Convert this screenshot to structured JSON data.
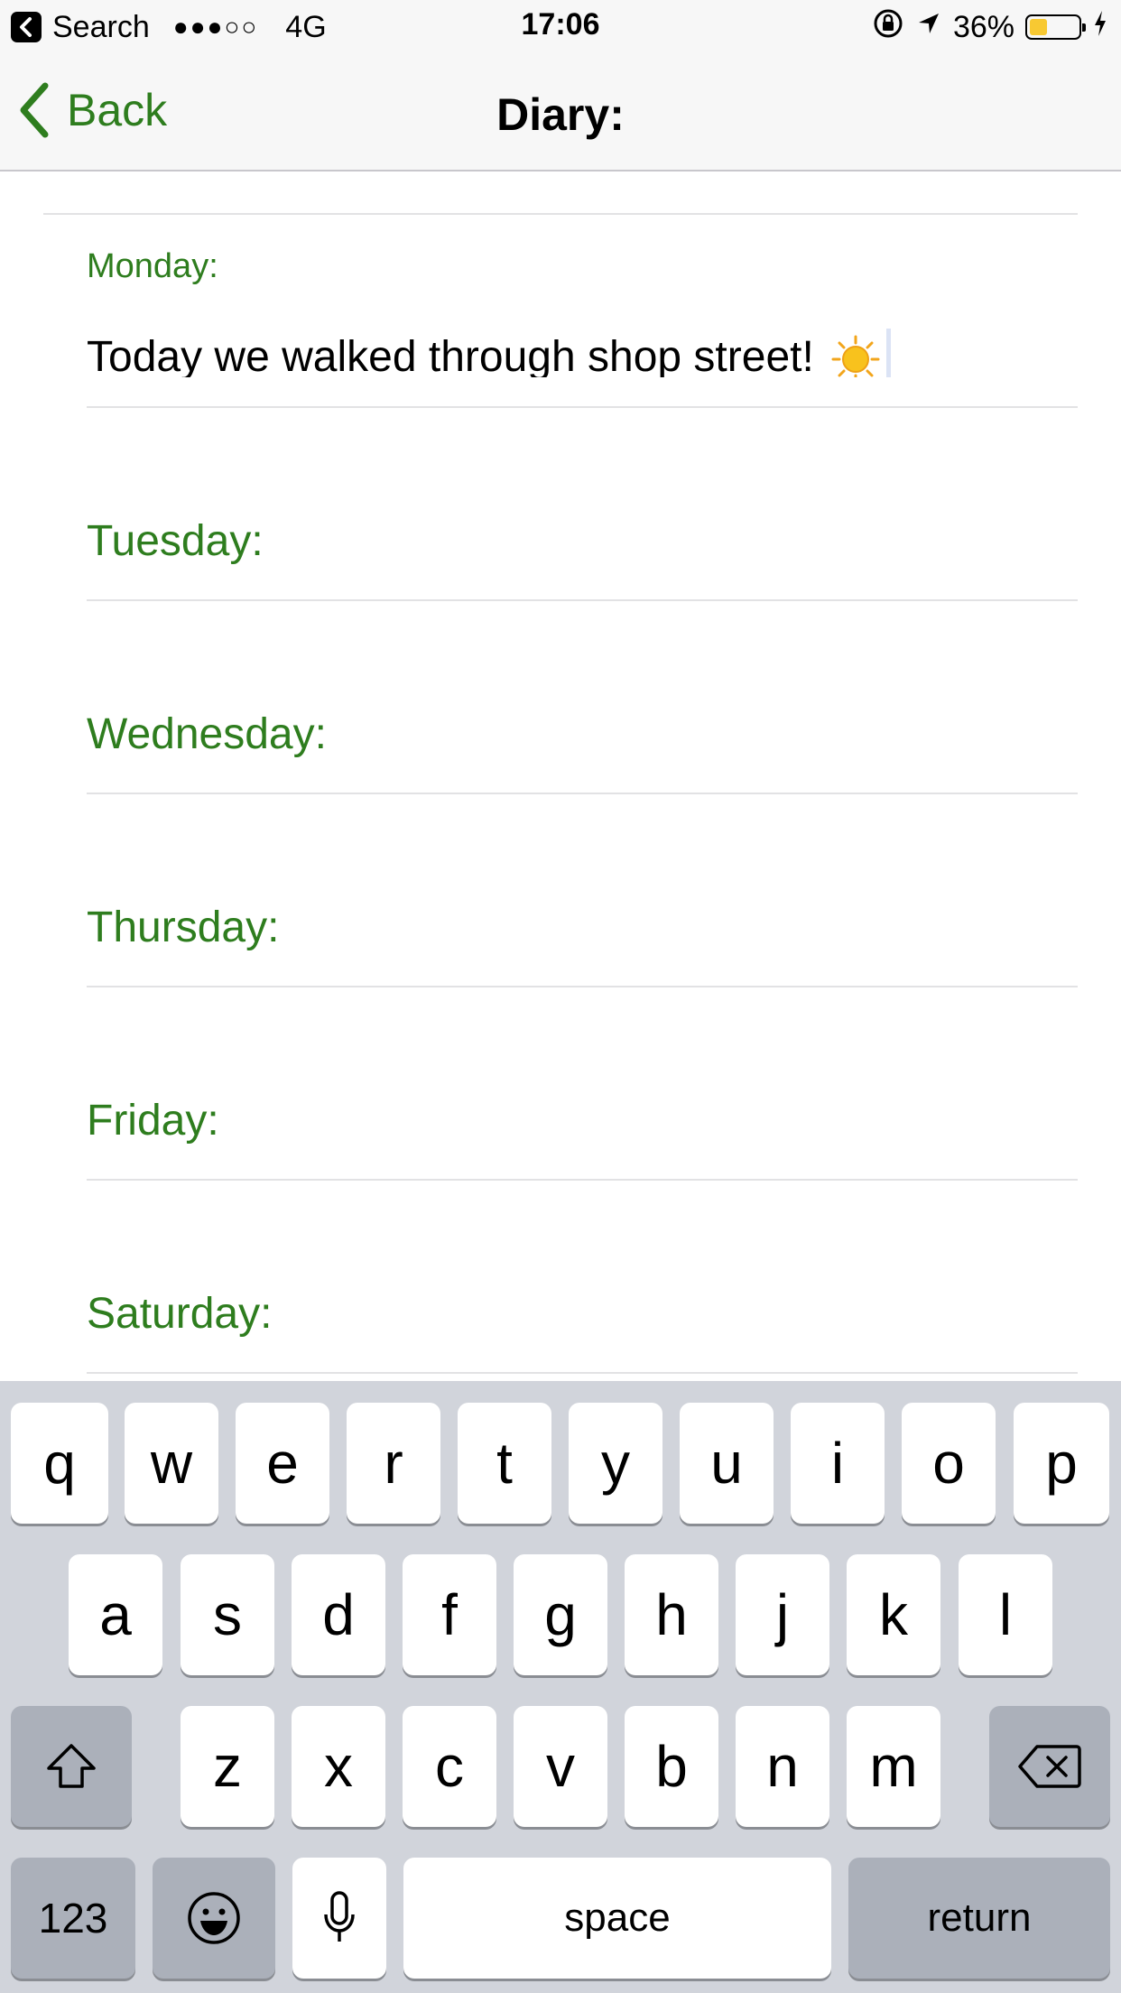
{
  "status_bar": {
    "back_app": "Search",
    "signal": "●●●○○",
    "network": "4G",
    "time": "17:06",
    "battery_percent": "36%",
    "battery_level": 0.36,
    "battery_color": "#f8c932"
  },
  "nav": {
    "back_label": "Back",
    "title": "Diary:"
  },
  "diary": {
    "monday": {
      "label": "Monday:",
      "text": "Today we walked through shop street!",
      "emoji_icon": "sun-icon"
    },
    "days": [
      {
        "label": "Tuesday:"
      },
      {
        "label": "Wednesday:"
      },
      {
        "label": "Thursday:"
      },
      {
        "label": "Friday:"
      },
      {
        "label": "Saturday:"
      }
    ]
  },
  "keyboard": {
    "row1": [
      "q",
      "w",
      "e",
      "r",
      "t",
      "y",
      "u",
      "i",
      "o",
      "p"
    ],
    "row2": [
      "a",
      "s",
      "d",
      "f",
      "g",
      "h",
      "j",
      "k",
      "l"
    ],
    "row3": [
      "z",
      "x",
      "c",
      "v",
      "b",
      "n",
      "m"
    ],
    "numbers_label": "123",
    "space_label": "space",
    "return_label": "return"
  },
  "colors": {
    "accent": "#2e7d1e",
    "keyboard_bg": "#d1d4db"
  }
}
